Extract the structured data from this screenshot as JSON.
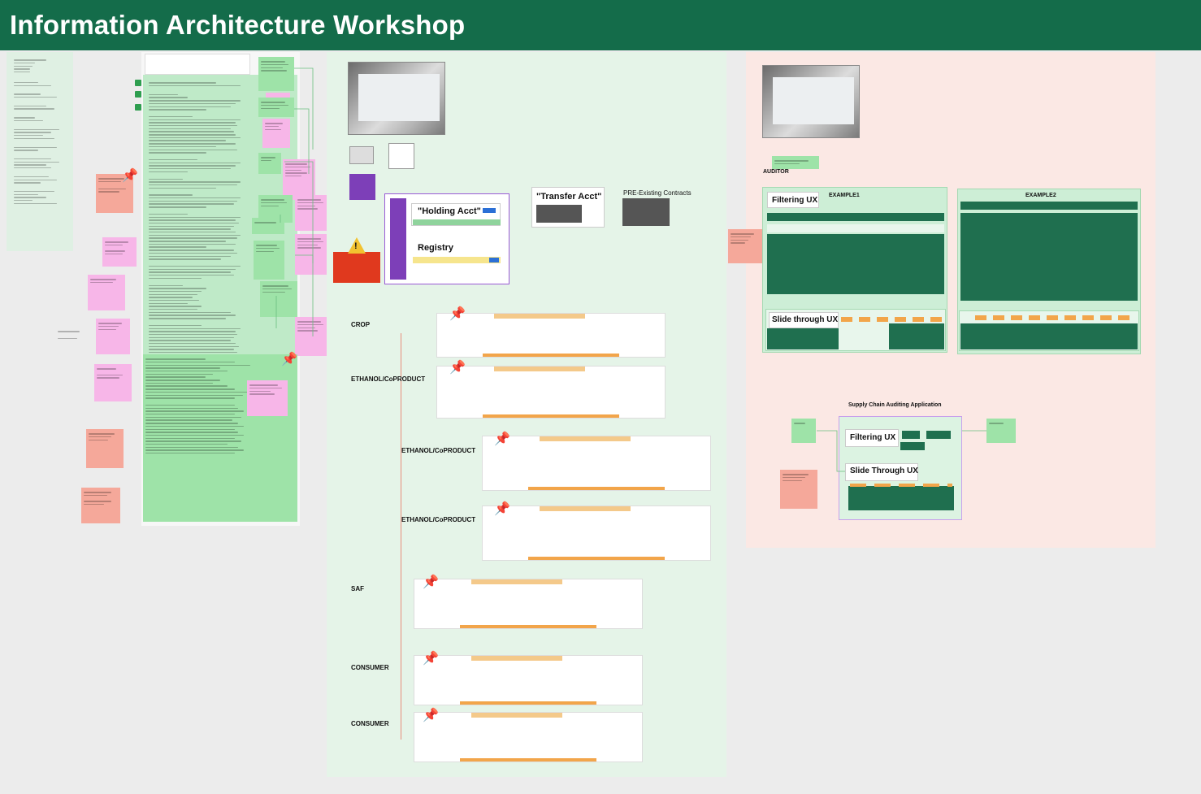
{
  "header": {
    "title": "Information Architecture Workshop"
  },
  "canvas": {
    "notes_column": {
      "lines": [
        "We traceby",
        "Classes",
        "Items",
        "rect",
        "mess"
      ]
    },
    "holding": {
      "holding_label": "\"Holding Acct\"",
      "registry_label": "Registry",
      "transfer_label": "\"Transfer Acct\"",
      "pre_existing_label": "PRE-Existing Contracts",
      "warning_icon": "warning-triangle-icon"
    },
    "flow": {
      "steps": [
        {
          "label": "CROP"
        },
        {
          "label": "ETHANOL/CoPRODUCT"
        },
        {
          "label": "ETHANOL/CoPRODUCT"
        },
        {
          "label": "ETHANOL/CoPRODUCT"
        },
        {
          "label": "SAF"
        },
        {
          "label": "CONSUMER"
        },
        {
          "label": "CONSUMER"
        }
      ]
    },
    "auditor": {
      "label": "AUDITOR",
      "example1": "EXAMPLE1",
      "example2": "EXAMPLE2",
      "filtering_ux": "Filtering UX",
      "slide_through_ux": "Slide through UX",
      "app_title": "Supply Chain Auditing Application",
      "app_filtering": "Filtering UX",
      "app_slide": "Slide Through UX"
    }
  },
  "colors": {
    "header_bg": "#146c4a",
    "sticky_green": "#9ee3a8",
    "sticky_pink": "#f7b6e8",
    "sticky_salmon": "#f5a89a",
    "dark_green": "#1f6f4f",
    "purple": "#7d3fb8",
    "orange": "#f2a54a",
    "red": "#e0391e"
  }
}
